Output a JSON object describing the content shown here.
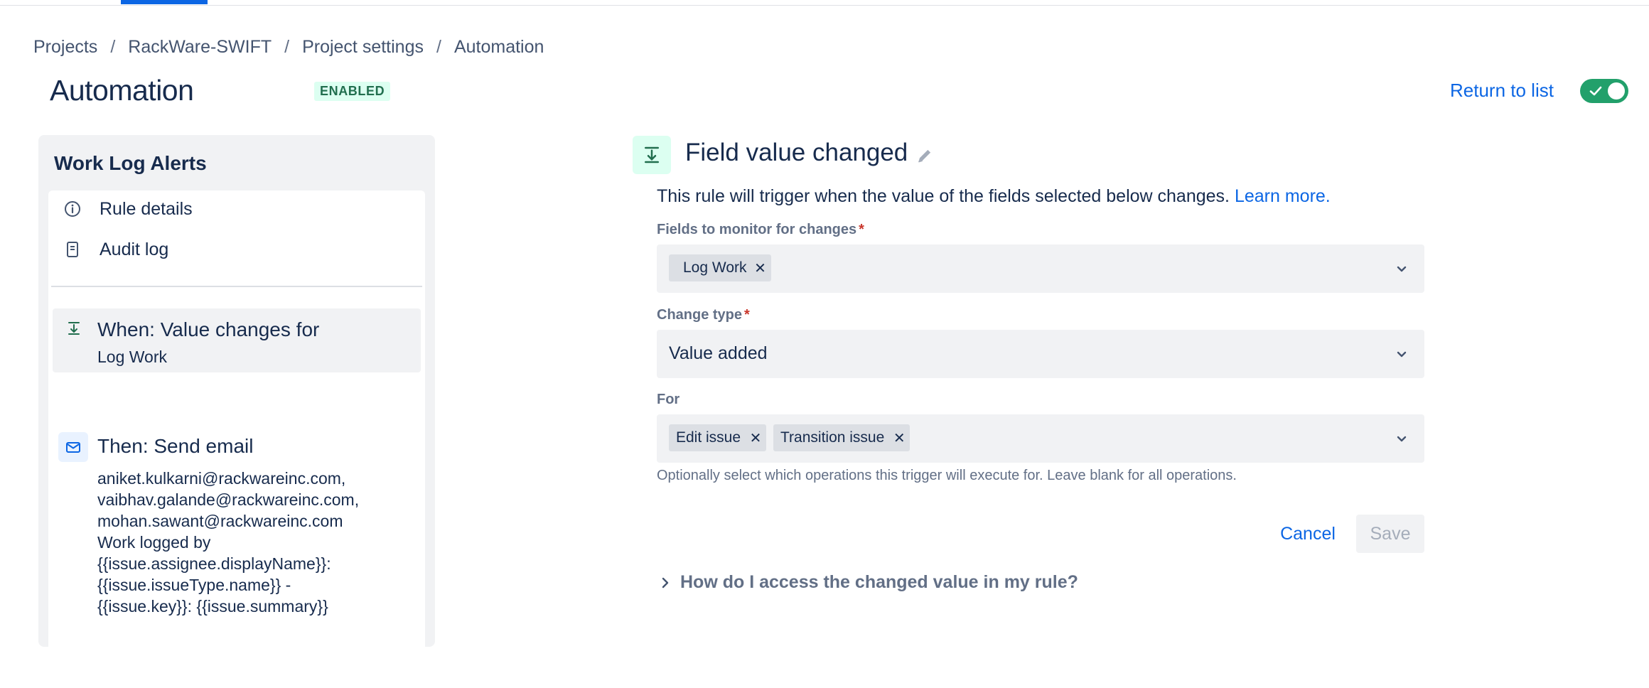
{
  "breadcrumb": {
    "items": [
      "Projects",
      "RackWare-SWIFT",
      "Project settings",
      "Automation"
    ],
    "separator": "/"
  },
  "header": {
    "title": "Automation",
    "status": "ENABLED",
    "return_label": "Return to list",
    "toggle_on": true
  },
  "rule": {
    "name": "Work Log Alerts",
    "menu": [
      {
        "label": "Rule details",
        "icon": "info-icon"
      },
      {
        "label": "Audit log",
        "icon": "document-icon"
      }
    ],
    "when": {
      "title": "When: Value changes for",
      "subtitle": "Log Work",
      "icon": "field-trigger-icon"
    },
    "then": {
      "title": "Then: Send email",
      "icon": "mail-icon",
      "lines": [
        "aniket.kulkarni@rackwareinc.com,",
        "vaibhav.galande@rackwareinc.com,",
        "mohan.sawant@rackwareinc.com",
        "Work logged by",
        "{{issue.assignee.displayName}}:",
        "{{issue.issueType.name}} -",
        "{{issue.key}}: {{issue.summary}}"
      ]
    }
  },
  "editor": {
    "title": "Field value changed",
    "description": "This rule will trigger when the value of the fields selected below changes.",
    "learn_more": "Learn more.",
    "fields_label": "Fields to monitor for changes",
    "fields_tags": [
      "Log Work"
    ],
    "change_type_label": "Change type",
    "change_type_value": "Value added",
    "for_label": "For",
    "for_tags": [
      "Edit issue",
      "Transition issue"
    ],
    "for_help": "Optionally select which operations this trigger will execute for. Leave blank for all operations.",
    "required_mark": "*",
    "cancel_label": "Cancel",
    "save_label": "Save",
    "faq_label": "How do I access the changed value in my rule?"
  },
  "colors": {
    "accent": "#0c66e4",
    "enabled_bg": "#dcfff1",
    "enabled_text": "#216e4e",
    "toggle_on": "#22a06b",
    "required": "#c9372c"
  }
}
